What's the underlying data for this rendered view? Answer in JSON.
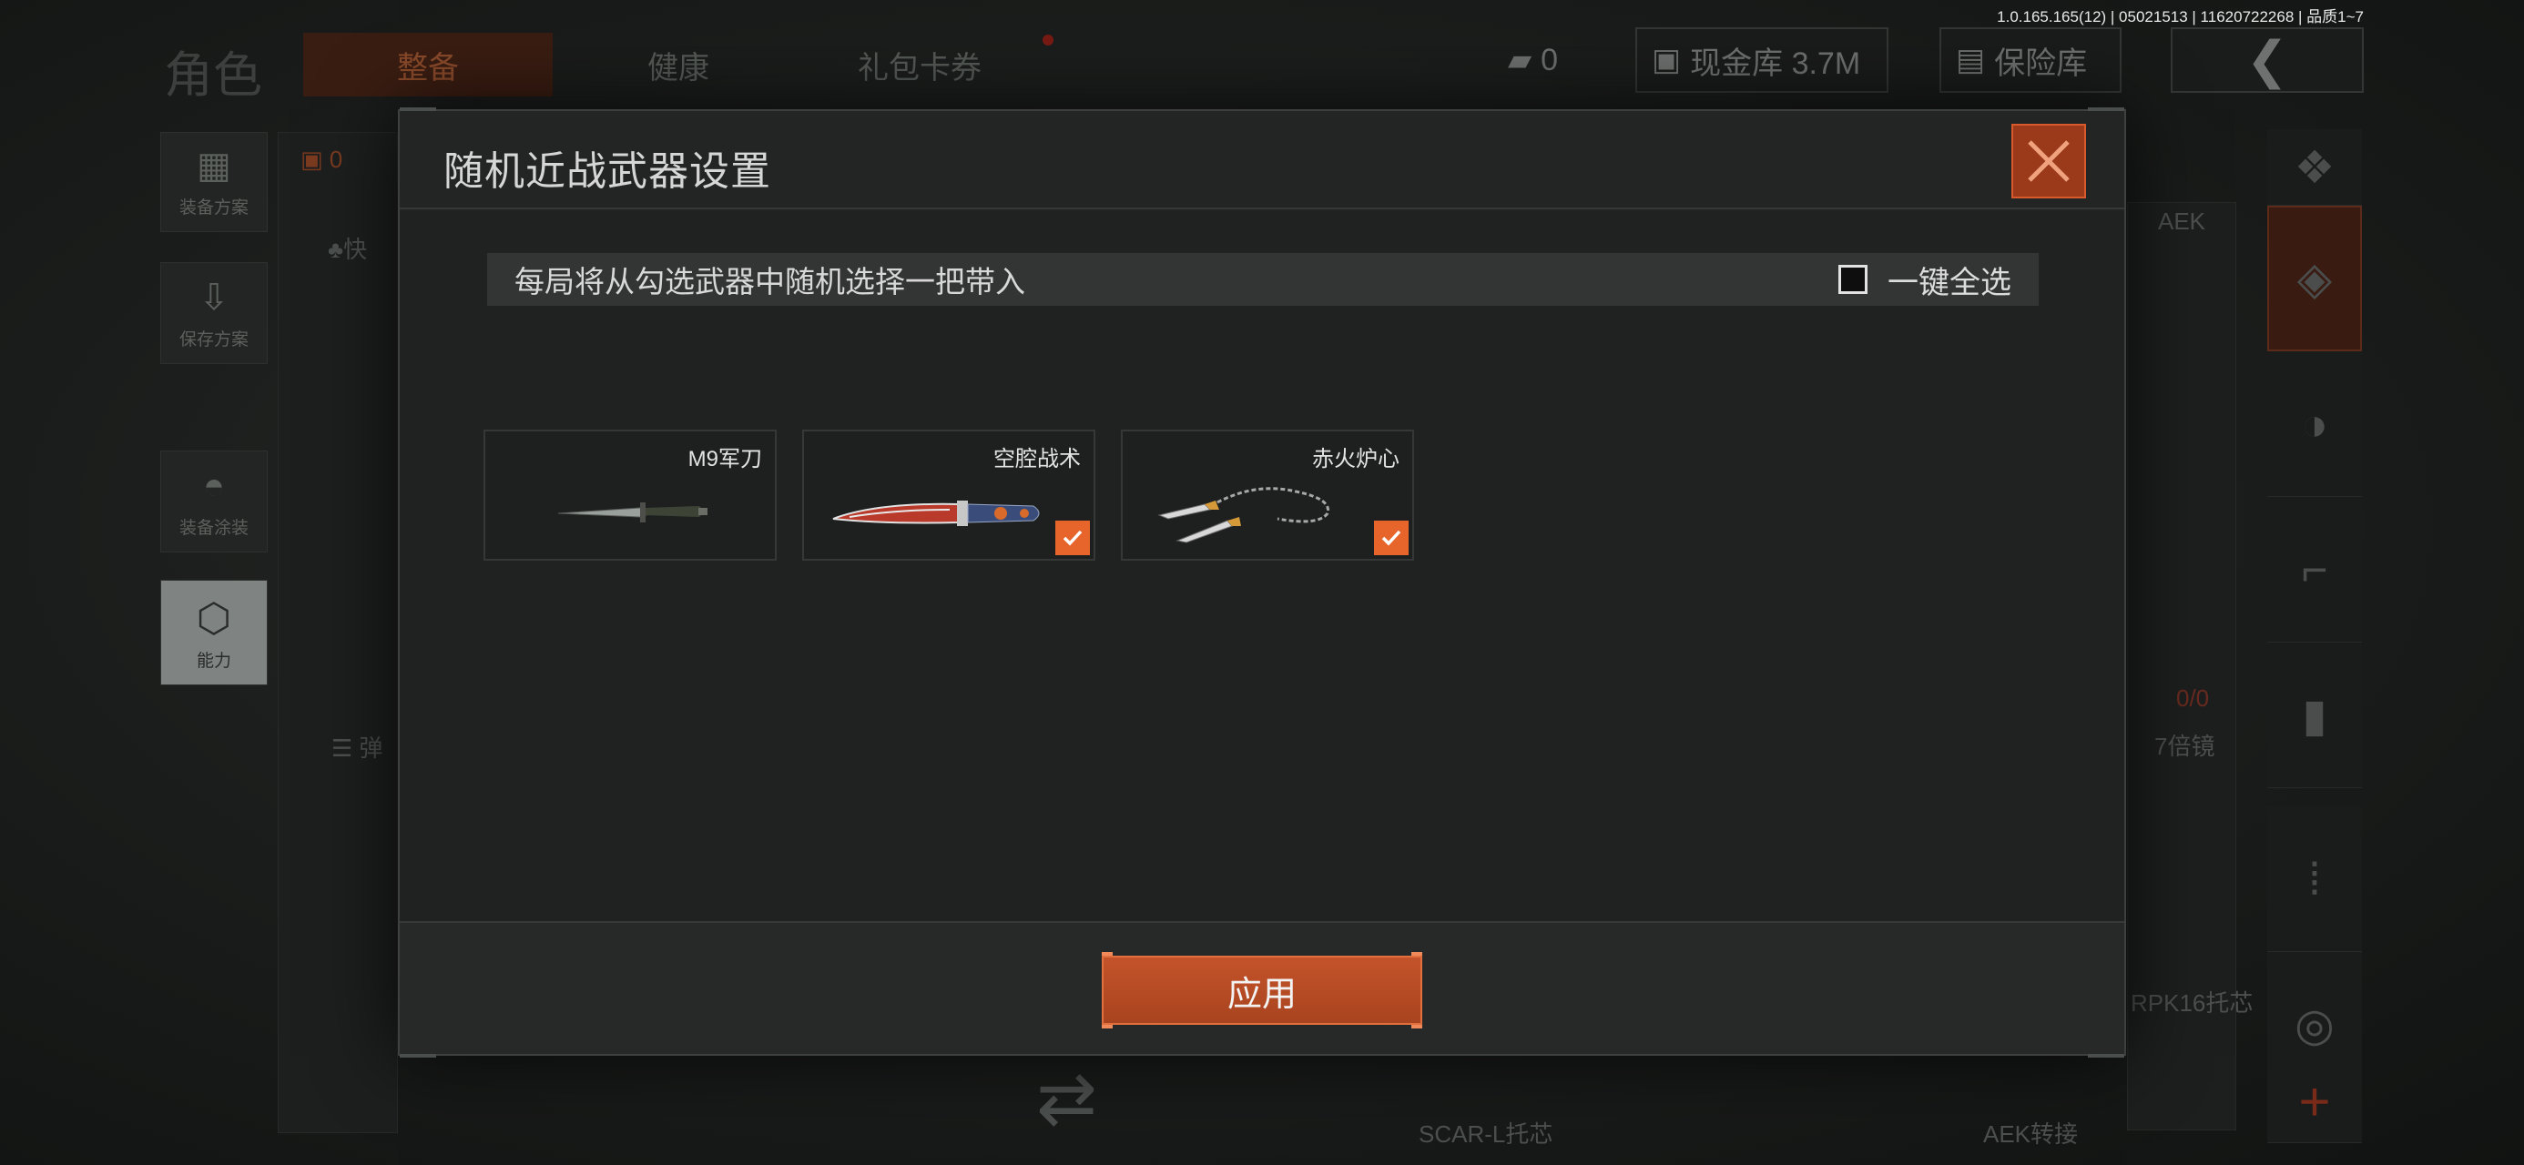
{
  "version_info": "1.0.165.165(12) | 05021513 | 11620722268 | 品质1~7",
  "background": {
    "page_title": "角色",
    "tabs": [
      {
        "label": "整备",
        "active": true
      },
      {
        "label": "健康",
        "active": false
      },
      {
        "label": "礼包卡券",
        "active": false
      }
    ],
    "currency_count": "0",
    "cash_store": "现金库 3.7M",
    "vault": "保险库",
    "left_menu": [
      {
        "label": "装备方案"
      },
      {
        "label": "保存方案"
      },
      {
        "label": "装备涂装"
      },
      {
        "label": "能力"
      }
    ],
    "armor_count": "0",
    "quick_label": "快",
    "ammo_label": "弹",
    "right_weapon_name": "AEK",
    "ammo_ratio": "0/0",
    "scope_label": "7倍镜",
    "grip_label": "RPK16托芯",
    "bottom_labels": [
      "SCAR-L托芯",
      "AEK转接"
    ]
  },
  "modal": {
    "title": "随机近战武器设置",
    "info_text": "每局将从勾选武器中随机选择一把带入",
    "select_all_label": "一键全选",
    "select_all_checked": false,
    "weapons": [
      {
        "name": "M9军刀",
        "checked": false,
        "icon": "combat-knife-icon"
      },
      {
        "name": "空腔战术",
        "checked": true,
        "icon": "tactical-knife-icon"
      },
      {
        "name": "赤火炉心",
        "checked": true,
        "icon": "chain-kunai-icon"
      }
    ],
    "apply_label": "应用"
  },
  "colors": {
    "accent": "#e7642b",
    "close_bg": "#9a3a1a",
    "apply_bg": "#b34a24"
  }
}
